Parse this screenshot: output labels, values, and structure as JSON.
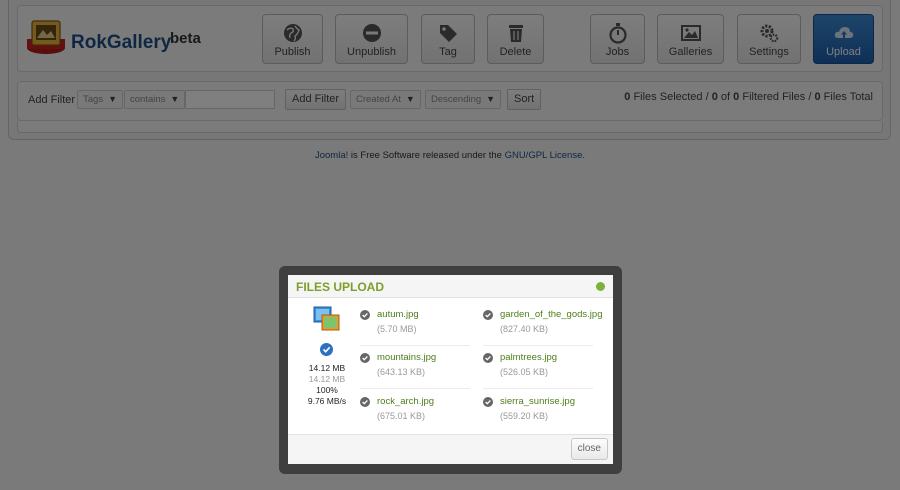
{
  "app": {
    "brand": "RokGallery",
    "badge": "beta"
  },
  "toolbar": {
    "publish": "Publish",
    "unpublish": "Unpublish",
    "tag": "Tag",
    "delete": "Delete",
    "jobs": "Jobs",
    "galleries": "Galleries",
    "settings": "Settings",
    "upload": "Upload"
  },
  "filter": {
    "add_filter_label": "Add Filter",
    "field_select": "Tags",
    "operator_select": "contains",
    "value_input": "",
    "add_filter_button": "Add Filter",
    "sort_field_select": "Created At",
    "sort_dir_select": "Descending",
    "sort_button": "Sort"
  },
  "status": {
    "selected": "0",
    "selected_label": "Files Selected /",
    "filtered_a": "0",
    "of_label": "of",
    "filtered_b": "0",
    "filtered_label": "Filtered Files /",
    "total": "0",
    "total_label": "Files Total"
  },
  "footer": {
    "joomla": "Joomla!",
    "middle": "is Free Software released under the",
    "license": "GNU/GPL License",
    "end": "."
  },
  "modal": {
    "title": "FILES UPLOAD",
    "stats": {
      "size_uploaded": "14.12 MB",
      "size_total": "14.12 MB",
      "percent": "100%",
      "speed": "9.76 MB/s"
    },
    "files": [
      {
        "name": "autum.jpg",
        "size": "(5.70 MB)"
      },
      {
        "name": "garden_of_the_gods.jpg",
        "size": "(827.40 KB)"
      },
      {
        "name": "mountains.jpg",
        "size": "(643.13 KB)"
      },
      {
        "name": "palmtrees.jpg",
        "size": "(526.05 KB)"
      },
      {
        "name": "rock_arch.jpg",
        "size": "(675.01 KB)"
      },
      {
        "name": "sierra_sunrise.jpg",
        "size": "(559.20 KB)"
      }
    ],
    "close": "close"
  },
  "colors": {
    "brand_blue": "#1f4f86",
    "upload_button": "#2a73c4",
    "title_green": "#7e9e2b",
    "file_name_green": "#4e7e1a"
  },
  "icons": {
    "publish": "globe-icon",
    "unpublish": "no-entry-icon",
    "tag": "tag-icon",
    "delete": "trash-icon",
    "jobs": "stopwatch-icon",
    "galleries": "picture-icon",
    "settings": "gears-icon",
    "upload": "cloud-upload-icon"
  }
}
